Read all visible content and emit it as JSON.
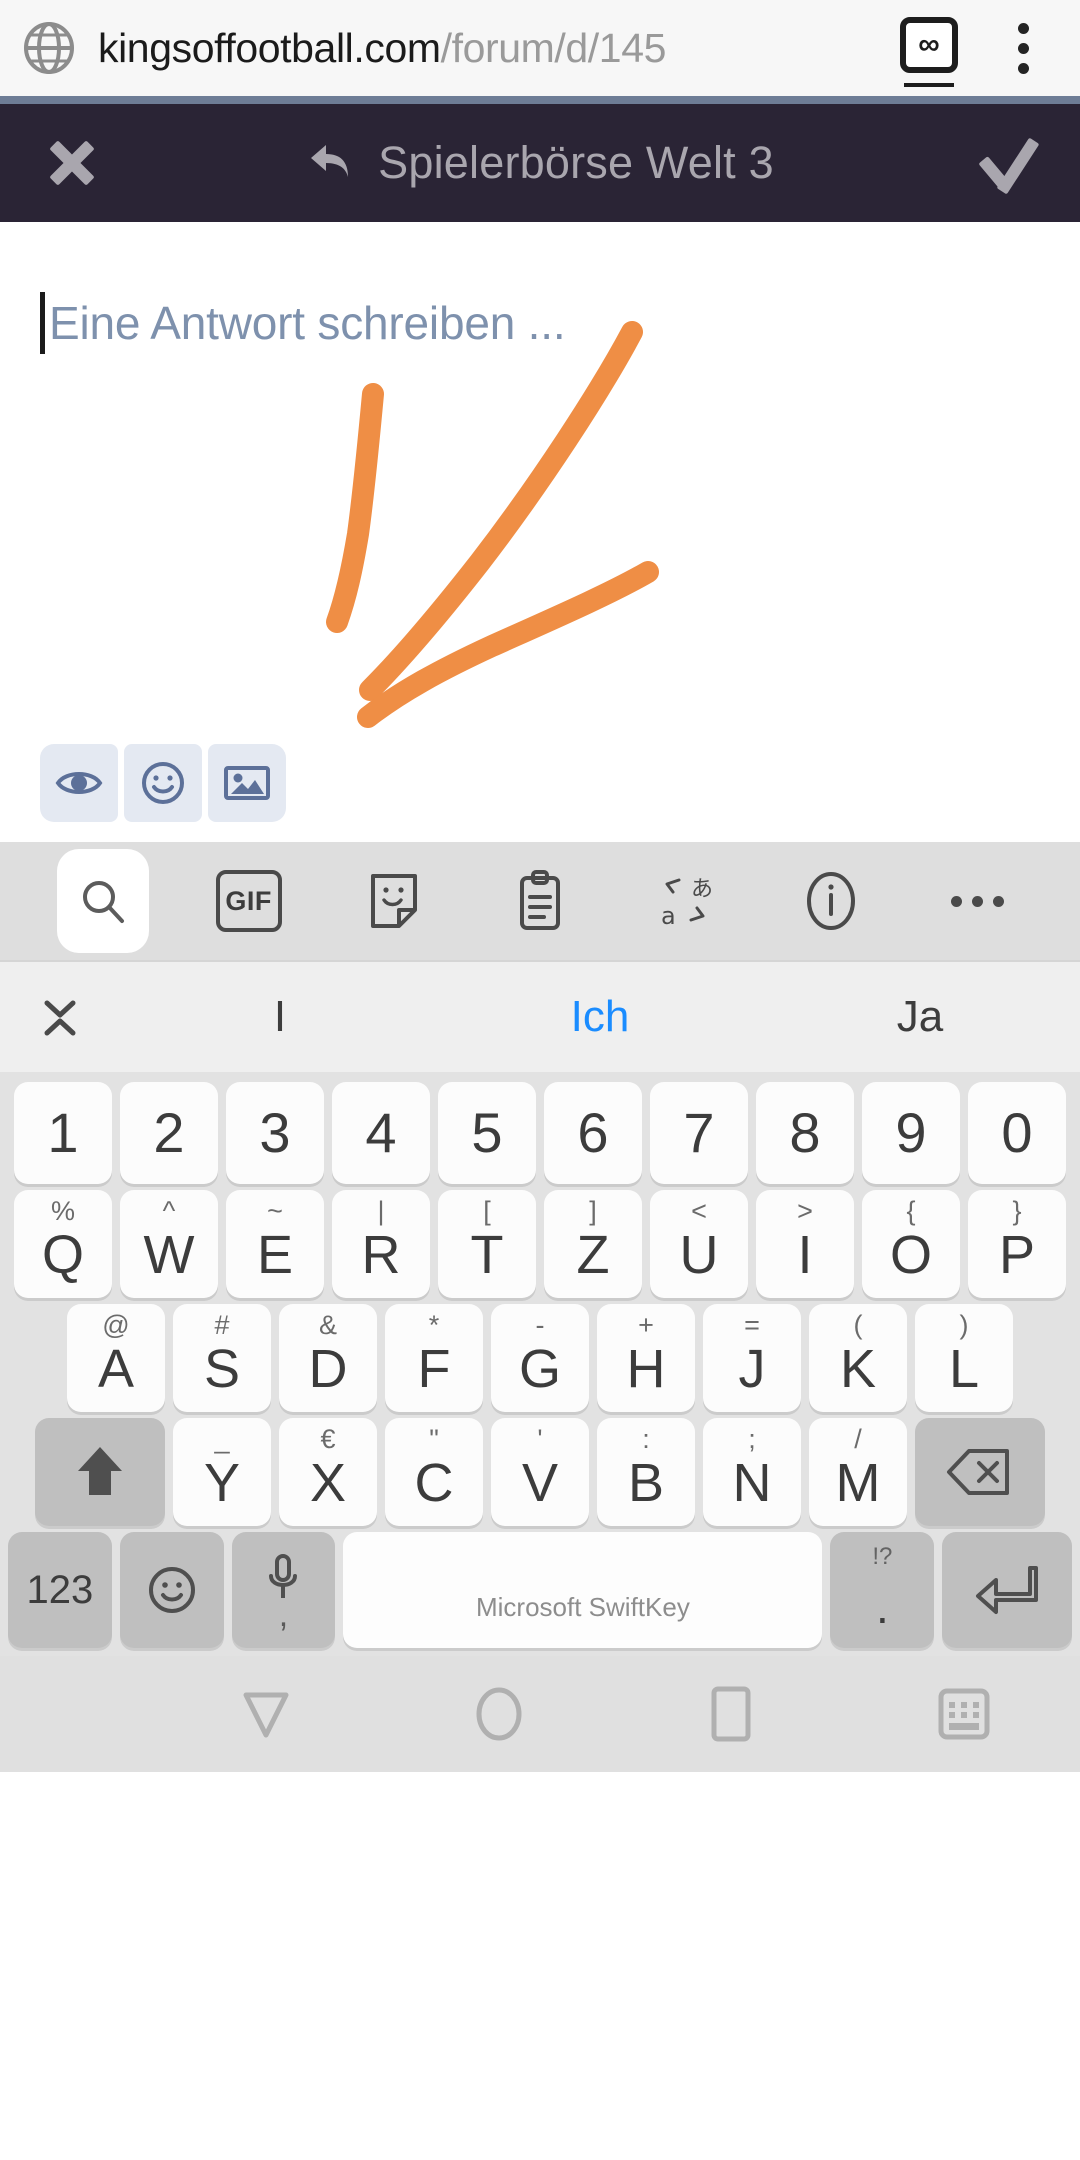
{
  "browser": {
    "url_main": "kingsoffootball.com",
    "url_path": "/forum/d/145",
    "globe_icon": "globe-icon",
    "tab_count": "∞",
    "menu_icon": "kebab-menu-icon"
  },
  "appbar": {
    "close_icon": "close-icon",
    "reply_icon": "reply-arrow-icon",
    "title": "Spielerbörse Welt 3",
    "submit_icon": "checkmark-icon"
  },
  "composer": {
    "placeholder": "Eine Antwort schreiben ...",
    "value": "",
    "annotation_color": "#ef8e45",
    "buttons": [
      {
        "name": "preview-button",
        "icon": "eye-icon"
      },
      {
        "name": "emoji-button",
        "icon": "smiley-icon"
      },
      {
        "name": "image-button",
        "icon": "image-icon"
      }
    ],
    "button_bg": "#e4e9f2",
    "button_fg": "#5c7099"
  },
  "keyboard": {
    "brand": "Microsoft SwiftKey",
    "toolbar": [
      {
        "name": "keyboard-search-button",
        "icon": "search-icon",
        "label": ""
      },
      {
        "name": "keyboard-gif-button",
        "icon": "gif-icon",
        "label": "GIF"
      },
      {
        "name": "keyboard-sticker-button",
        "icon": "sticker-icon",
        "label": ""
      },
      {
        "name": "keyboard-clipboard-button",
        "icon": "clipboard-icon",
        "label": ""
      },
      {
        "name": "keyboard-translate-button",
        "icon": "translate-icon",
        "label": ""
      },
      {
        "name": "keyboard-info-button",
        "icon": "info-icon",
        "label": ""
      },
      {
        "name": "keyboard-more-button",
        "icon": "more-dots-icon",
        "label": ""
      }
    ],
    "predictions": [
      {
        "text": "I",
        "highlighted": false
      },
      {
        "text": "Ich",
        "highlighted": true
      },
      {
        "text": "Ja",
        "highlighted": false
      }
    ],
    "collapse_icon": "collapse-chevrons-icon",
    "highlight_color": "#1a8cff",
    "rows": {
      "numbers": [
        "1",
        "2",
        "3",
        "4",
        "5",
        "6",
        "7",
        "8",
        "9",
        "0"
      ],
      "row1": [
        {
          "main": "Q",
          "sub": "%"
        },
        {
          "main": "W",
          "sub": "^"
        },
        {
          "main": "E",
          "sub": "~"
        },
        {
          "main": "R",
          "sub": "|"
        },
        {
          "main": "T",
          "sub": "["
        },
        {
          "main": "Z",
          "sub": "]"
        },
        {
          "main": "U",
          "sub": "<"
        },
        {
          "main": "I",
          "sub": ">"
        },
        {
          "main": "O",
          "sub": "{"
        },
        {
          "main": "P",
          "sub": "}"
        }
      ],
      "row2": [
        {
          "main": "A",
          "sub": "@"
        },
        {
          "main": "S",
          "sub": "#"
        },
        {
          "main": "D",
          "sub": "&"
        },
        {
          "main": "F",
          "sub": "*"
        },
        {
          "main": "G",
          "sub": "-"
        },
        {
          "main": "H",
          "sub": "+"
        },
        {
          "main": "J",
          "sub": "="
        },
        {
          "main": "K",
          "sub": "("
        },
        {
          "main": "L",
          "sub": ")"
        }
      ],
      "row3": [
        {
          "main": "Y",
          "sub": "_"
        },
        {
          "main": "X",
          "sub": "€"
        },
        {
          "main": "C",
          "sub": "\""
        },
        {
          "main": "V",
          "sub": "'"
        },
        {
          "main": "B",
          "sub": ":"
        },
        {
          "main": "N",
          "sub": ";"
        },
        {
          "main": "M",
          "sub": "/"
        }
      ]
    },
    "shift_icon": "shift-arrow-icon",
    "backspace_icon": "backspace-icon",
    "numeric_key": "123",
    "emoji_key_icon": "smiley-icon",
    "mic_key_icon": "microphone-icon",
    "mic_key_sub": ",",
    "punctuation_key": ".",
    "punctuation_key_sub": "!?",
    "enter_icon": "enter-arrow-icon"
  },
  "navbar": [
    {
      "name": "nav-back-button",
      "icon": "back-triangle-icon"
    },
    {
      "name": "nav-home-button",
      "icon": "home-circle-icon"
    },
    {
      "name": "nav-recents-button",
      "icon": "recents-square-icon"
    },
    {
      "name": "nav-hide-keyboard-button",
      "icon": "hide-keyboard-icon"
    }
  ]
}
